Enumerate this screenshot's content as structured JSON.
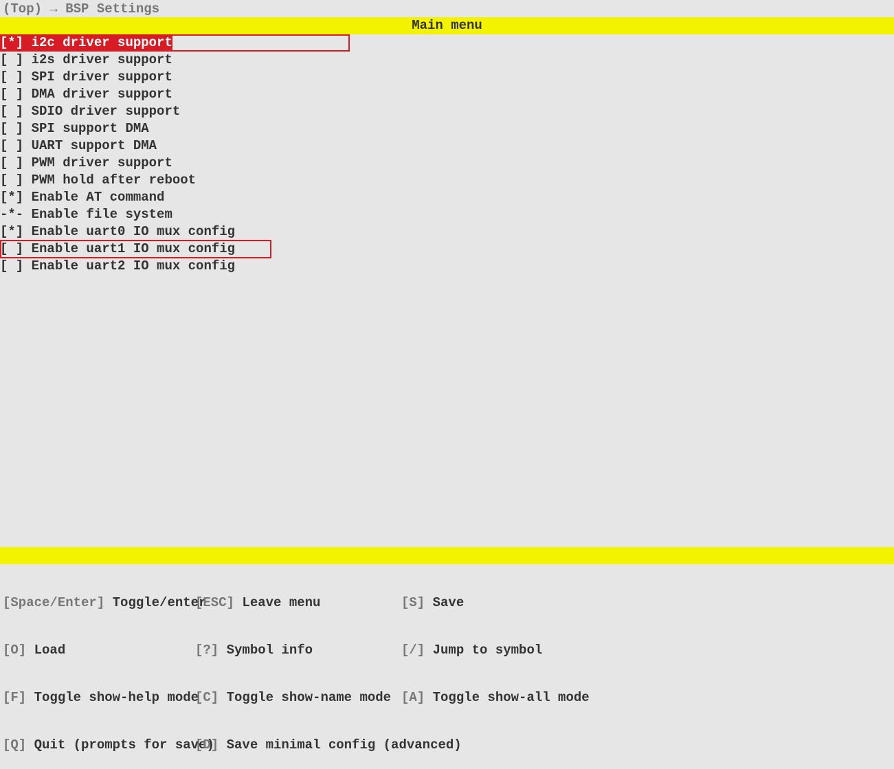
{
  "breadcrumb": "(Top) → BSP Settings",
  "title": "Main menu",
  "items": [
    {
      "indicator": "[*]",
      "label": " i2c driver support",
      "selected": true
    },
    {
      "indicator": "[ ]",
      "label": " i2s driver support",
      "selected": false
    },
    {
      "indicator": "[ ]",
      "label": " SPI driver support",
      "selected": false
    },
    {
      "indicator": "[ ]",
      "label": " DMA driver support",
      "selected": false
    },
    {
      "indicator": "[ ]",
      "label": " SDIO driver support",
      "selected": false
    },
    {
      "indicator": "[ ]",
      "label": " SPI support DMA",
      "selected": false
    },
    {
      "indicator": "[ ]",
      "label": " UART support DMA",
      "selected": false
    },
    {
      "indicator": "[ ]",
      "label": " PWM driver support",
      "selected": false
    },
    {
      "indicator": "[ ]",
      "label": " PWM hold after reboot",
      "selected": false
    },
    {
      "indicator": "[*]",
      "label": " Enable AT command",
      "selected": false
    },
    {
      "indicator": "-*-",
      "label": " Enable file system",
      "selected": false
    },
    {
      "indicator": "[*]",
      "label": " Enable uart0 IO mux config",
      "selected": false
    },
    {
      "indicator": "[ ]",
      "label": " Enable uart1 IO mux config",
      "selected": false
    },
    {
      "indicator": "[ ]",
      "label": " Enable uart2 IO mux config",
      "selected": false
    }
  ],
  "footer": {
    "rows": [
      {
        "c1k": "[Space/Enter]",
        "c1v": " Toggle/enter",
        "c2k": "[ESC]",
        "c2v": " Leave menu",
        "c3k": "[S]",
        "c3v": " Save"
      },
      {
        "c1k": "[O]",
        "c1v": " Load",
        "c2k": "[?]",
        "c2v": " Symbol info",
        "c3k": "[/]",
        "c3v": " Jump to symbol"
      },
      {
        "c1k": "[F]",
        "c1v": " Toggle show-help mode",
        "c2k": "[C]",
        "c2v": " Toggle show-name mode",
        "c3k": "[A]",
        "c3v": " Toggle show-all mode"
      },
      {
        "c1k": "[Q]",
        "c1v": " Quit (prompts for save)",
        "c2k": "[D]",
        "c2v": " Save minimal config (advanced)",
        "c3k": "",
        "c3v": ""
      }
    ]
  }
}
